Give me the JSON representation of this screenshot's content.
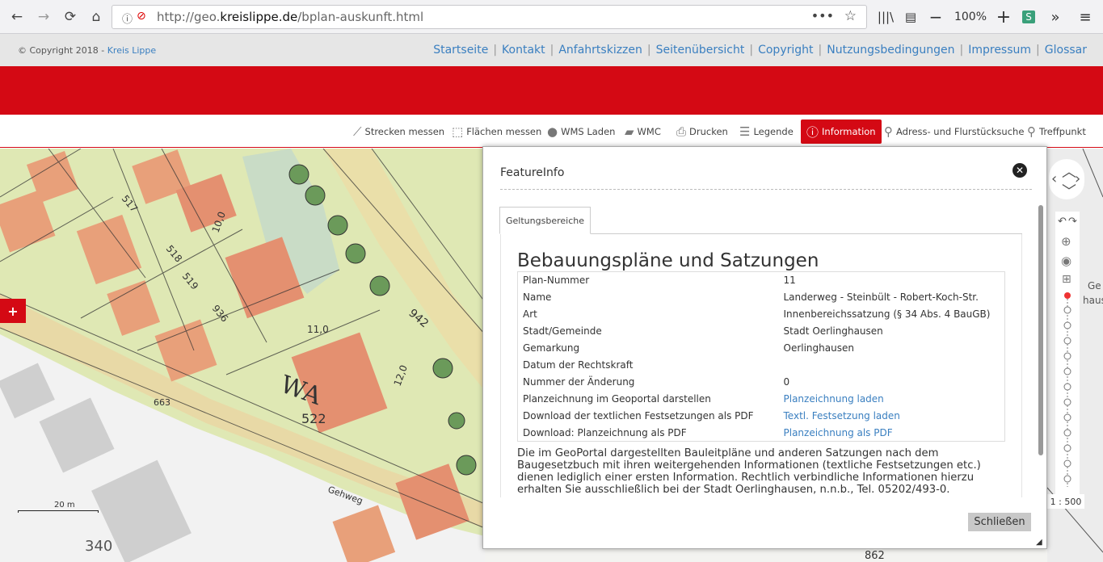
{
  "browser": {
    "url_host_prefix": "http://geo.",
    "url_host_main": "kreislippe.de",
    "url_path": "/bplan-auskunft.html",
    "zoom": "100%"
  },
  "header": {
    "copyright_prefix": "© Copyright 2018 - ",
    "copyright_link": "Kreis Lippe",
    "links": [
      "Startseite",
      "Kontakt",
      "Anfahrtskizzen",
      "Seitenübersicht",
      "Copyright",
      "Nutzungsbedingungen",
      "Impressum",
      "Glossar"
    ]
  },
  "toolbar": {
    "strecken": "Strecken messen",
    "flaechen": "Flächen messen",
    "wms": "WMS Laden",
    "wmc": "WMC",
    "drucken": "Drucken",
    "legende": "Legende",
    "information": "Information",
    "suche": "Adress- und Flurstücksuche",
    "treffpunkt": "Treffpunkt"
  },
  "map": {
    "scale_label": "20 m",
    "scale_ratio": "1 : 500",
    "labels": [
      "WA",
      "522",
      "517",
      "518",
      "519",
      "936",
      "942",
      "663",
      "Gehweg",
      "340",
      "862",
      "Ge",
      "hause",
      "10,0",
      "12,0",
      "11,0"
    ]
  },
  "dialog": {
    "title": "FeatureInfo",
    "tab": "Geltungsbereiche",
    "heading": "Bebauungspläne und Satzungen",
    "rows": [
      {
        "label": "Plan-Nummer",
        "value": "11",
        "link": false
      },
      {
        "label": "Name",
        "value": "Landerweg - Steinbült - Robert-Koch-Str.",
        "link": false
      },
      {
        "label": "Art",
        "value": "Innenbereichssatzung (§ 34 Abs. 4 BauGB)",
        "link": false
      },
      {
        "label": "Stadt/Gemeinde",
        "value": "Stadt Oerlinghausen",
        "link": false
      },
      {
        "label": "Gemarkung",
        "value": "Oerlinghausen",
        "link": false
      },
      {
        "label": "Datum der Rechtskraft",
        "value": "",
        "link": false
      },
      {
        "label": "Nummer der Änderung",
        "value": "0",
        "link": false
      },
      {
        "label": "Planzeichnung im Geoportal darstellen",
        "value": "Planzeichnung laden",
        "link": true
      },
      {
        "label": "Download der textlichen Festsetzungen als PDF",
        "value": "Textl. Festsetzung laden",
        "link": true
      },
      {
        "label": "Download: Planzeichnung als PDF",
        "value": "Planzeichnung als PDF",
        "link": true
      }
    ],
    "note": "Die im GeoPortal dargestellten Bauleitpläne und anderen Satzungen nach dem Baugesetzbuch mit ihren weitergehenden Informationen (textliche Festsetzungen etc.) dienen lediglich einer ersten Information. Rechtlich verbindliche Informationen hierzu erhalten Sie ausschließlich bei der Stadt Oerlinghausen, n.n.b., Tel. 05202/493-0.",
    "close_button": "Schließen"
  },
  "colors": {
    "brand_red": "#d40914",
    "link_blue": "#3a7fc0"
  }
}
